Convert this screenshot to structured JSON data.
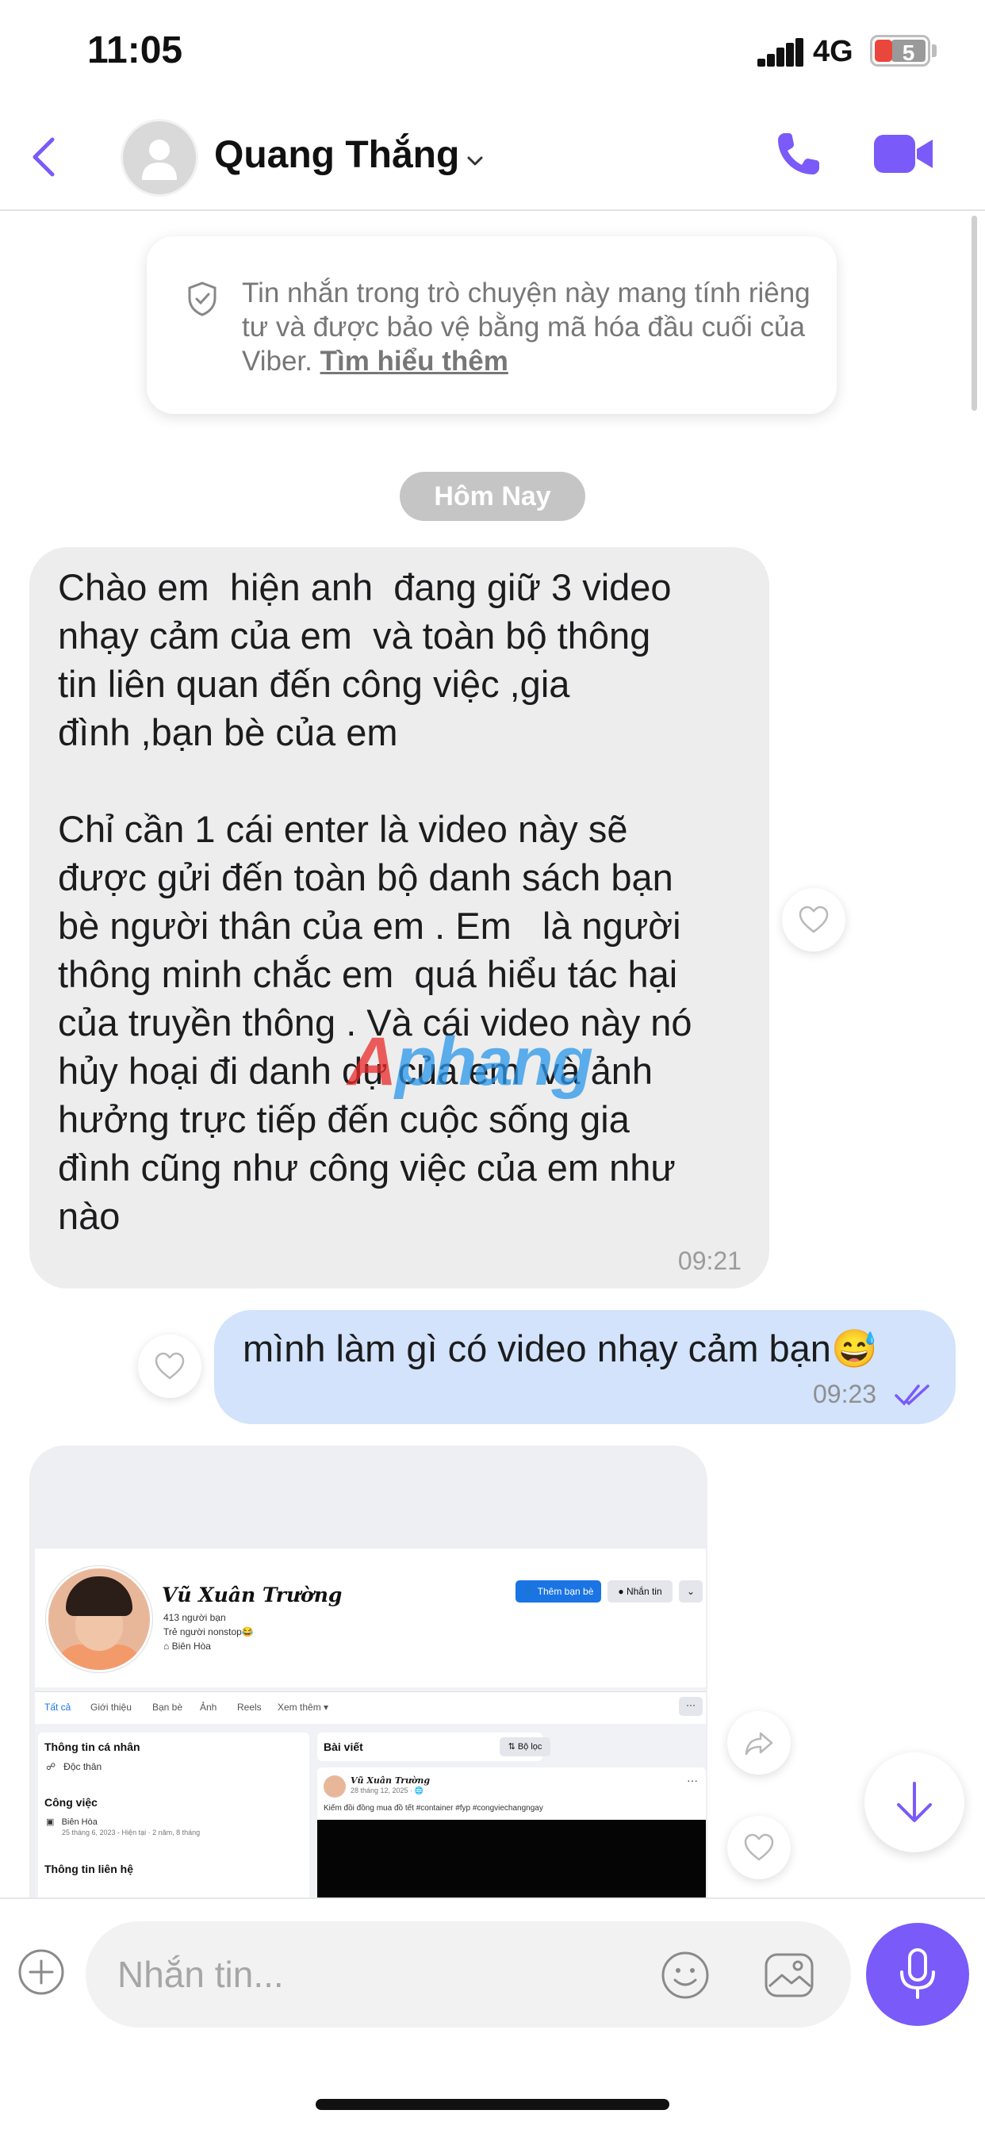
{
  "status_bar": {
    "time": "11:05",
    "network": "4G",
    "battery": "5"
  },
  "header": {
    "contact_name": "Quang Thắng"
  },
  "notice": {
    "text": "Tin nhắn trong trò chuyện này mang tính riêng tư và được bảo vệ bằng mã hóa đầu cuối của Viber. ",
    "link": "Tìm hiểu thêm"
  },
  "date_separator": "Hôm Nay",
  "messages": [
    {
      "direction": "incoming",
      "text": "Chào em  hiện anh  đang giữ 3 video\nnhạy cảm của em  và toàn bộ thông\ntin liên quan đến công việc ,gia\nđình ,bạn bè của em\n\nChỉ cần 1 cái enter là video này sẽ\nđược gửi đến toàn bộ danh sách bạn\nbè người thân của em . Em   là người\nthông minh chắc em  quá hiểu tác hại\ncủa truyền thông . Và cái video này nó\nhủy hoại đi danh dự của em  và ảnh\nhưởng trực tiếp đến cuộc sống gia\nđình cũng như công việc của em như\nnào",
      "time": "09:21"
    },
    {
      "direction": "outgoing",
      "text": "mình làm gì có video nhạy cảm bạn😅",
      "time": "09:23"
    }
  ],
  "image_message": {
    "profile_name": "Vũ Xuân Trường",
    "friends": "413 người bạn",
    "bio": "Trẻ người nonstop😂",
    "location": "Biên Hòa",
    "add_friend": "Thêm bạn bè",
    "message_btn": "Nhắn tin",
    "tabs": [
      "Tất cả",
      "Giới thiệu",
      "Bạn bè",
      "Ảnh",
      "Reels",
      "Xem thêm ▾"
    ],
    "intro_title": "Thông tin cá nhân",
    "status": "Độc thân",
    "work_title": "Công việc",
    "work_place": "Biên Hòa",
    "work_date": "25 tháng 6, 2023 - Hiện tại · 2 năm, 8 tháng",
    "contact_title": "Thông tin liên hệ",
    "posts_title": "Bài viết",
    "filter": "Bộ lọc",
    "post_author": "Vũ Xuân Trường",
    "post_date": "28 tháng 12, 2025 · ",
    "post_text": "Kiếm đồi đồng mua đồ tết #container #fyp #congviechangngay"
  },
  "watermark": "Aphang",
  "input": {
    "placeholder": "Nhắn tin..."
  },
  "colors": {
    "accent": "#7a5af8",
    "outgoing_bubble": "#d2e3fb",
    "incoming_bubble": "#ededed"
  }
}
